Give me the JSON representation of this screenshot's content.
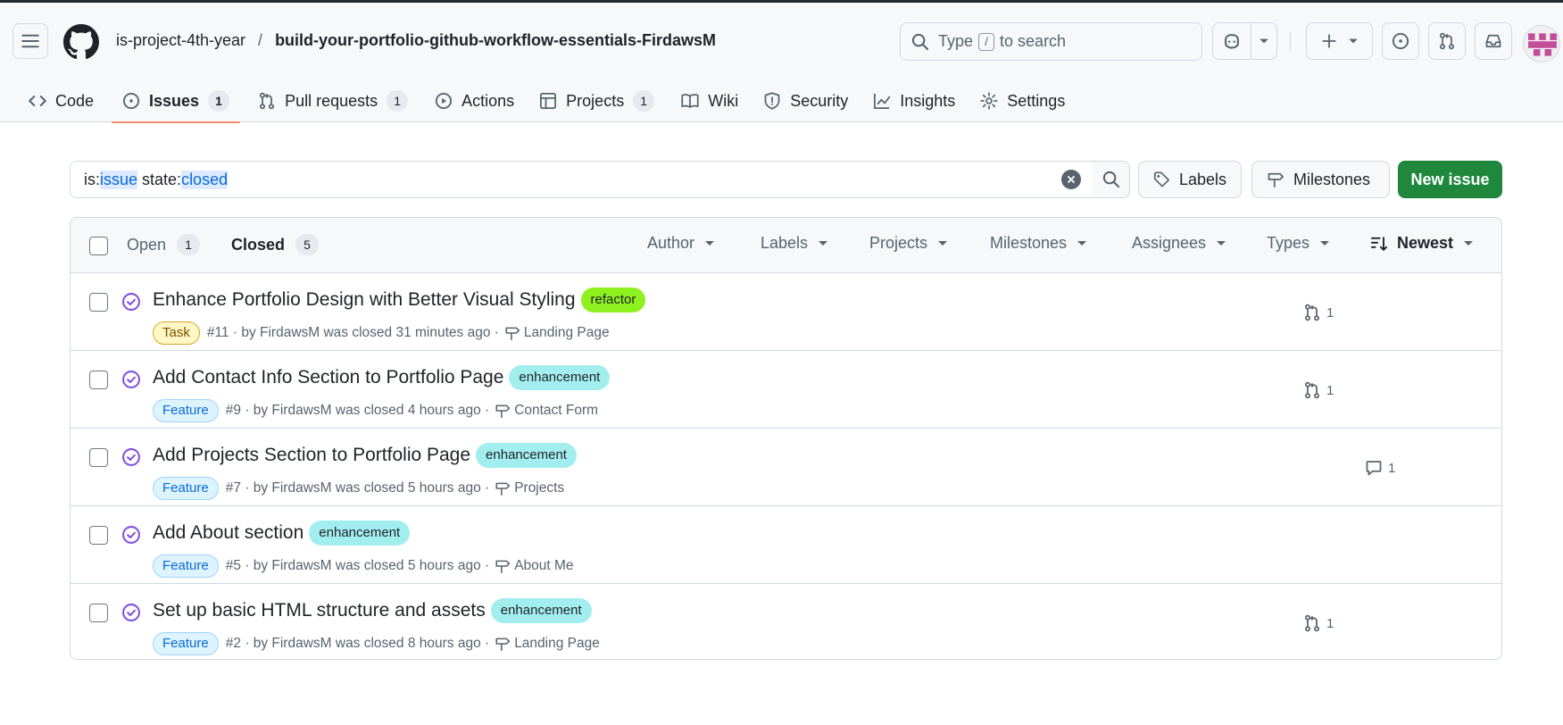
{
  "header": {
    "owner": "is-project-4th-year",
    "separator": "/",
    "repo": "build-your-portfolio-github-workflow-essentials-FirdawsM",
    "search_prefix": "Type",
    "search_key": "/",
    "search_suffix": "to search"
  },
  "tabs": [
    {
      "label": "Code",
      "icon": "code-icon"
    },
    {
      "label": "Issues",
      "count": "1",
      "icon": "issue-opened-icon",
      "selected": true
    },
    {
      "label": "Pull requests",
      "count": "1",
      "icon": "git-pull-request-icon"
    },
    {
      "label": "Actions",
      "icon": "play-icon"
    },
    {
      "label": "Projects",
      "count": "1",
      "icon": "table-icon"
    },
    {
      "label": "Wiki",
      "icon": "book-icon"
    },
    {
      "label": "Security",
      "icon": "shield-icon"
    },
    {
      "label": "Insights",
      "icon": "graph-icon"
    },
    {
      "label": "Settings",
      "icon": "gear-icon"
    }
  ],
  "filter": {
    "query_is": "is:",
    "query_issue": "issue",
    "query_state": " state:",
    "query_closed": "closed"
  },
  "buttons": {
    "labels": "Labels",
    "milestones": "Milestones",
    "new_issue": "New issue"
  },
  "list_header": {
    "open_label": "Open",
    "open_count": "1",
    "closed_label": "Closed",
    "closed_count": "5",
    "menus": [
      "Author",
      "Labels",
      "Projects",
      "Milestones",
      "Assignees",
      "Types"
    ],
    "sort_label": "Newest"
  },
  "issues": [
    {
      "title": "Enhance Portfolio Design with Better Visual Styling",
      "label": "refactor",
      "type": "Task",
      "meta": "#11 · by FirdawsM was closed 31 minutes ago ·",
      "milestone": "Landing Page",
      "side_icon": "git-pull-request-icon",
      "side_count": "1"
    },
    {
      "title": "Add Contact Info Section to Portfolio Page",
      "label": "enhancement",
      "type": "Feature",
      "meta": "#9 · by FirdawsM was closed 4 hours ago ·",
      "milestone": "Contact Form",
      "side_icon": "git-pull-request-icon",
      "side_count": "1"
    },
    {
      "title": "Add Projects Section to Portfolio Page",
      "label": "enhancement",
      "type": "Feature",
      "meta": "#7 · by FirdawsM was closed 5 hours ago ·",
      "milestone": "Projects",
      "side_icon": "comment-icon",
      "side_count": "1"
    },
    {
      "title": "Add About section",
      "label": "enhancement",
      "type": "Feature",
      "meta": "#5 · by FirdawsM was closed 5 hours ago ·",
      "milestone": "About Me"
    },
    {
      "title": "Set up basic HTML structure and assets",
      "label": "enhancement",
      "type": "Feature",
      "meta": "#2 · by FirdawsM was closed 8 hours ago ·",
      "milestone": "Landing Page",
      "side_icon": "git-pull-request-icon",
      "side_count": "1"
    }
  ],
  "colors": {
    "primary_button": "#1f883d",
    "closed_issue": "#8250df",
    "refactor_label": "#8ef01f",
    "enhancement_label": "#a2eeef",
    "selected_tab_underline": "#fd8c73"
  }
}
